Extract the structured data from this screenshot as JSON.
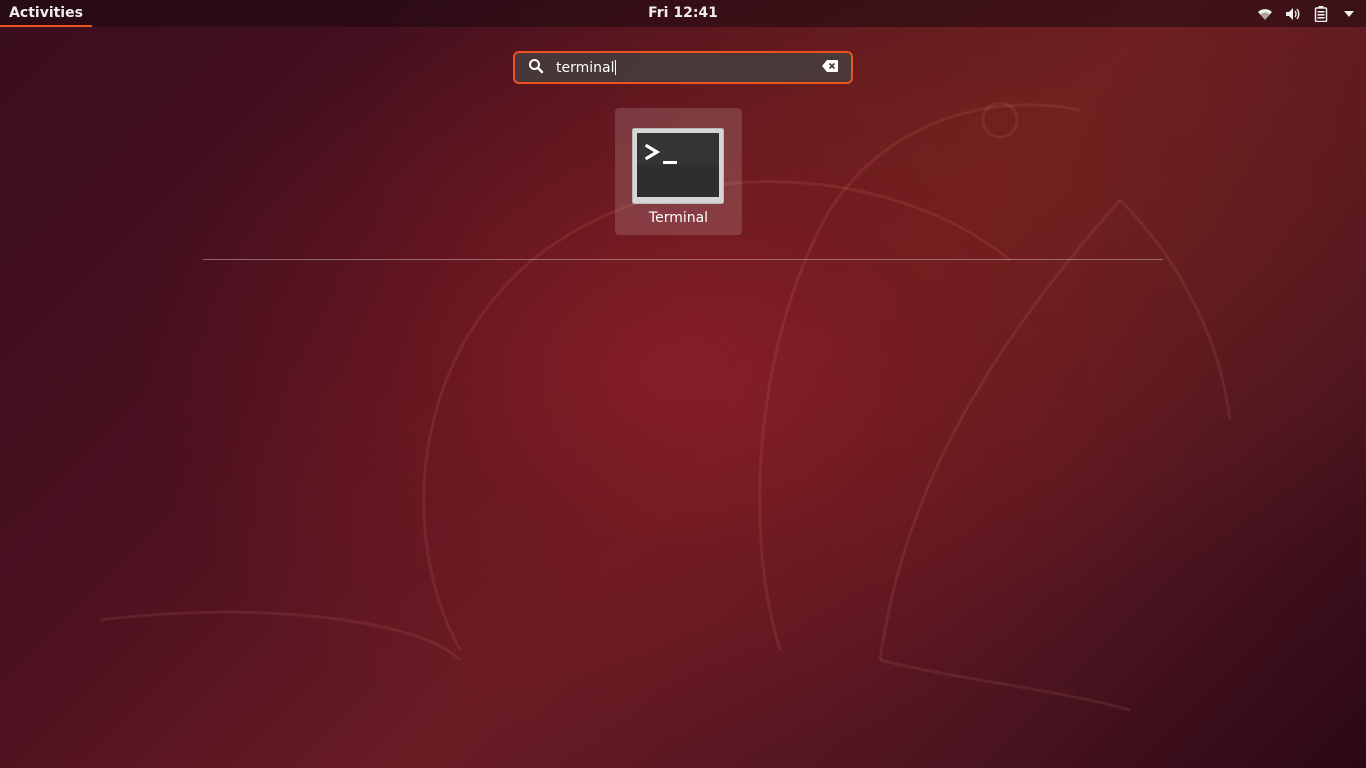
{
  "top_panel": {
    "activities_label": "Activities",
    "clock": "Fri 12:41",
    "tray_icons": [
      "wifi-icon",
      "volume-icon",
      "battery-icon",
      "chevron-down-icon"
    ]
  },
  "search": {
    "value": "terminal",
    "icon": "search-icon",
    "clear_icon": "clear-icon"
  },
  "results": {
    "apps": [
      {
        "label": "Terminal",
        "icon": "terminal-icon"
      }
    ]
  },
  "colors": {
    "accent": "#e95420",
    "panel_text": "#eeeeec"
  }
}
